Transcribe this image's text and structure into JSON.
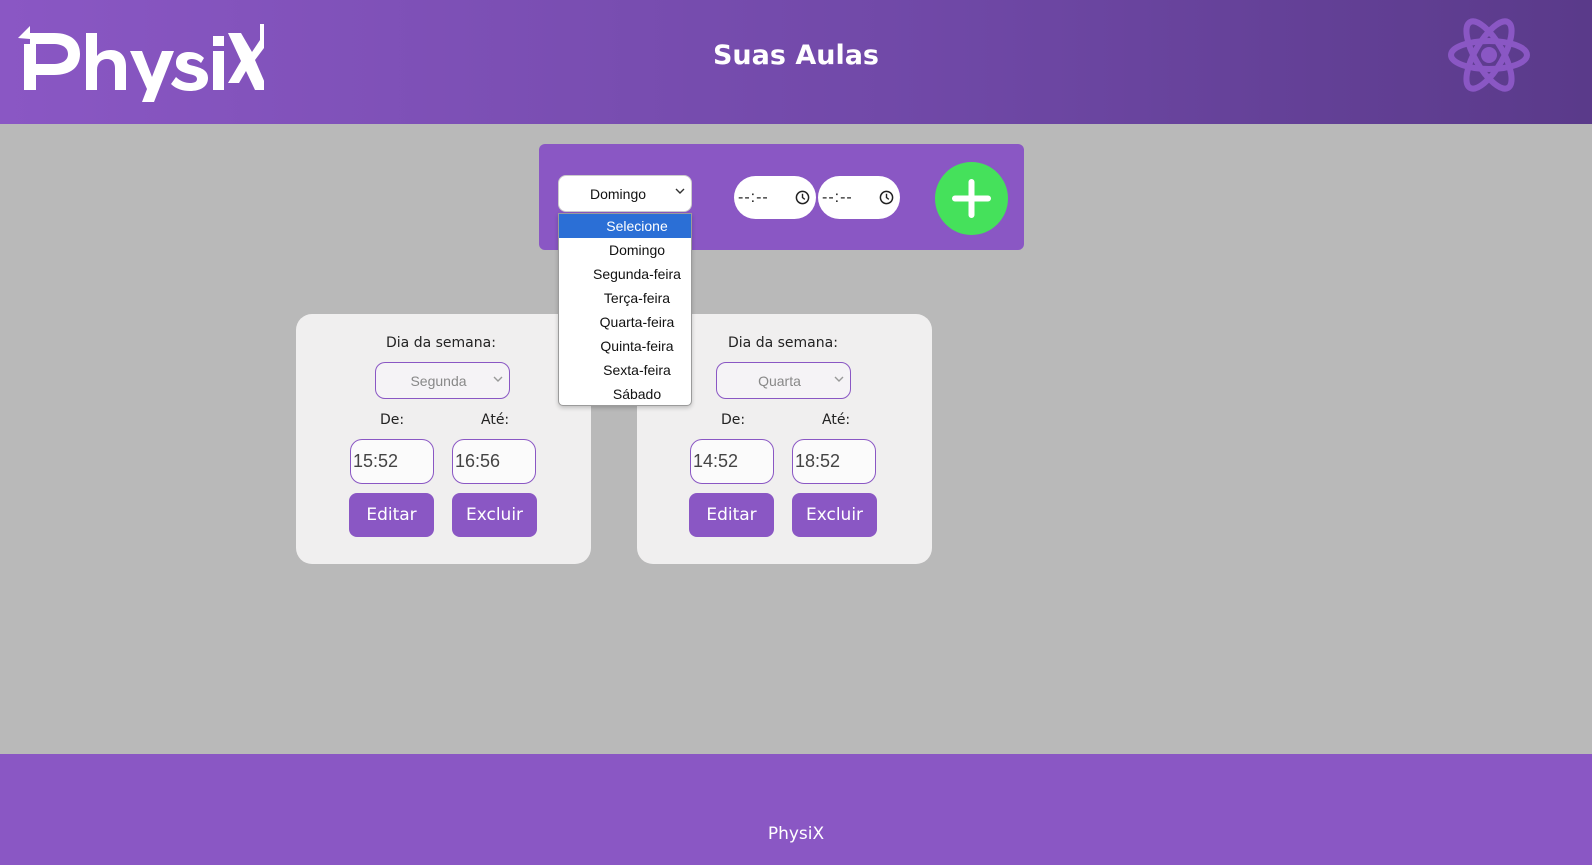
{
  "header": {
    "logo_text": "PhysiX",
    "title": "Suas Aulas",
    "atom_icon": "atom-icon"
  },
  "add_panel": {
    "day_selected": "Domingo",
    "start_time_placeholder": "--:--",
    "end_time_placeholder": "--:--",
    "add_icon": "plus-icon",
    "add_color": "#45e15b"
  },
  "dropdown": {
    "options": [
      "Selecione",
      "Domingo",
      "Segunda-feira",
      "Terça-feira",
      "Quarta-feira",
      "Quinta-feira",
      "Sexta-feira",
      "Sábado"
    ],
    "highlighted": "Selecione"
  },
  "cards": [
    {
      "weekday_label": "Dia da semana:",
      "weekday": "Segunda",
      "from_label": "De:",
      "to_label": "Até:",
      "from": "15:52",
      "to": "16:56",
      "edit_label": "Editar",
      "delete_label": "Excluir"
    },
    {
      "weekday_label": "Dia da semana:",
      "weekday": "Quarta",
      "from_label": "De:",
      "to_label": "Até:",
      "from": "14:52",
      "to": "18:52",
      "edit_label": "Editar",
      "delete_label": "Excluir"
    }
  ],
  "footer": {
    "text": "PhysiX"
  },
  "colors": {
    "primary": "#8a57c4",
    "background": "#b9b9b9",
    "card": "#f0efef",
    "highlight": "#2b6fd6"
  }
}
